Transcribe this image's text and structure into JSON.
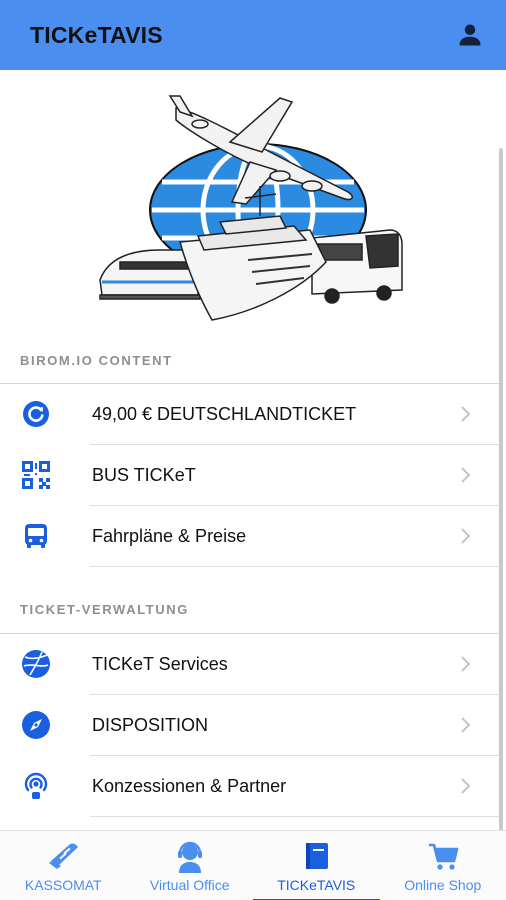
{
  "header": {
    "title": "TICKeTAVIS",
    "user_icon": "user-icon"
  },
  "colors": {
    "accent": "#4a8ef0",
    "icon_blue": "#1a5fe0",
    "section_text": "#8e8e93"
  },
  "sections": [
    {
      "title": "BIROM.IO CONTENT",
      "items": [
        {
          "label": "49,00 € DEUTSCHLANDTICKET",
          "icon": "refresh-circle-icon"
        },
        {
          "label": "BUS TICKeT",
          "icon": "qr-code-icon"
        },
        {
          "label": "Fahrpläne & Preise",
          "icon": "bus-icon"
        }
      ]
    },
    {
      "title": "TICKET-VERWALTUNG",
      "items": [
        {
          "label": "TICKeT Services",
          "icon": "globe-icon"
        },
        {
          "label": "DISPOSITION",
          "icon": "compass-icon"
        },
        {
          "label": "Konzessionen & Partner",
          "icon": "broadcast-icon"
        }
      ]
    }
  ],
  "tabs": [
    {
      "label": "KASSOMAT",
      "icon": "ticket-machine-icon",
      "active": false
    },
    {
      "label": "Virtual Office",
      "icon": "headset-icon",
      "active": false
    },
    {
      "label": "TICKeTAVIS",
      "icon": "book-icon",
      "active": true
    },
    {
      "label": "Online Shop",
      "icon": "cart-icon",
      "active": false
    }
  ]
}
